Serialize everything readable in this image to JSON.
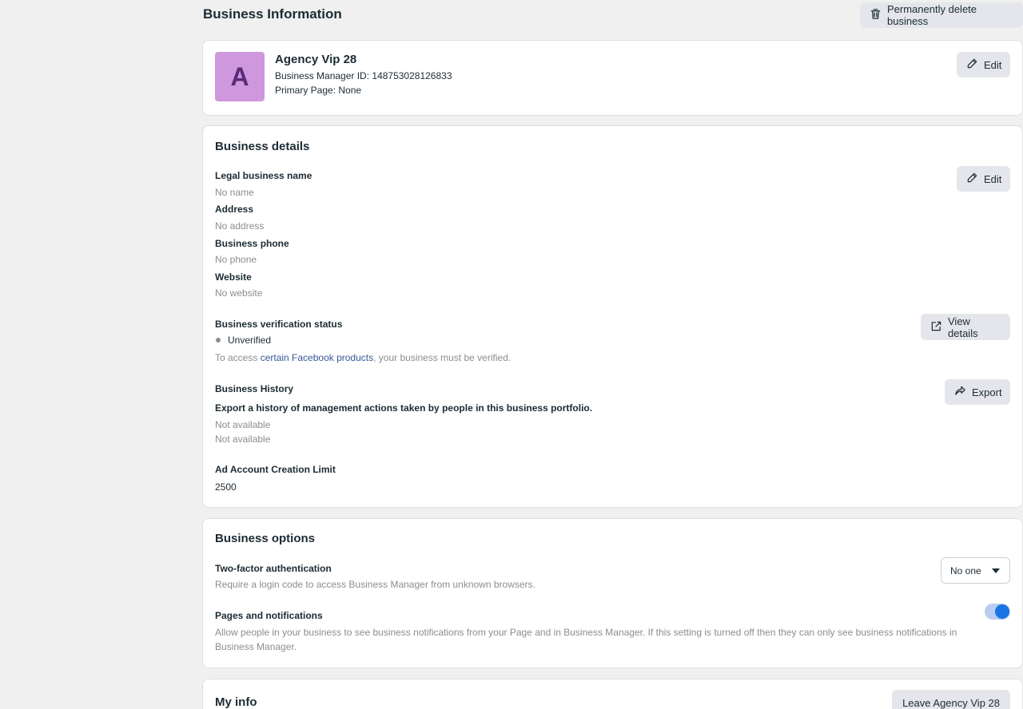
{
  "header": {
    "title": "Business Information",
    "delete_label": "Permanently delete business"
  },
  "profile": {
    "avatar_letter": "A",
    "name": "Agency Vip 28",
    "manager_id": "Business Manager ID: 148753028126833",
    "primary_page": "Primary Page: None",
    "edit_label": "Edit"
  },
  "details": {
    "title": "Business details",
    "edit_label": "Edit",
    "legal_name_label": "Legal business name",
    "legal_name_value": "No name",
    "address_label": "Address",
    "address_value": "No address",
    "phone_label": "Business phone",
    "phone_value": "No phone",
    "website_label": "Website",
    "website_value": "No website",
    "verification_label": "Business verification status",
    "verification_status": "Unverified",
    "verification_note_prefix": "To access ",
    "verification_note_link": "certain Facebook products",
    "verification_note_suffix": ", your business must be verified.",
    "view_details_label": "View details",
    "history_label": "Business History",
    "history_desc": "Export a history of management actions taken by people in this business portfolio.",
    "history_value_1": "Not available",
    "history_value_2": "Not available",
    "export_label": "Export",
    "limit_label": "Ad Account Creation Limit",
    "limit_value": "2500"
  },
  "options": {
    "title": "Business options",
    "two_factor_label": "Two-factor authentication",
    "two_factor_desc": "Require a login code to access Business Manager from unknown browsers.",
    "two_factor_value": "No one",
    "pages_label": "Pages and notifications",
    "pages_desc": "Allow people in your business to see business notifications from your Page and in Business Manager. If this setting is turned off then they can only see business notifications in Business Manager.",
    "pages_enabled": true
  },
  "my_info": {
    "title": "My info",
    "leave_label": "Leave Agency Vip 28"
  },
  "colors": {
    "accent": "#1b74e4",
    "avatar_bg": "#cf97dd",
    "link": "#385898"
  },
  "icons": {
    "delete": "trash-icon",
    "edit": "pencil-icon",
    "view_details": "external-link-icon",
    "export": "share-arrow-icon",
    "dropdown": "caret-down-icon"
  }
}
